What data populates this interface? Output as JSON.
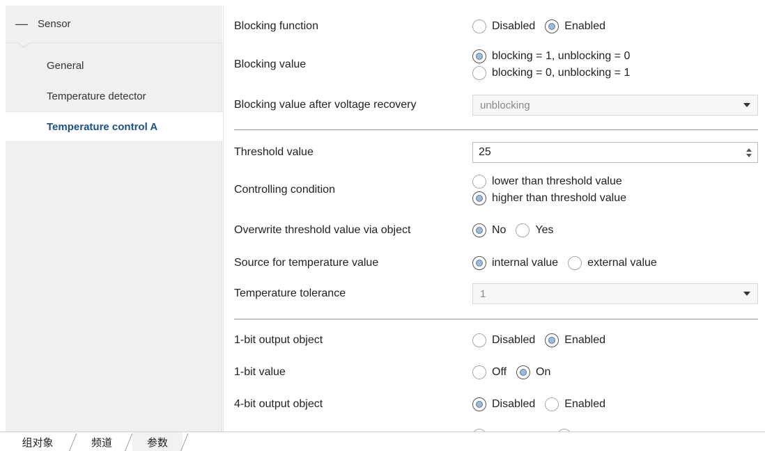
{
  "sidebar": {
    "root_label": "Sensor",
    "items": [
      {
        "label": "General",
        "active": false
      },
      {
        "label": "Temperature detector",
        "active": false
      },
      {
        "label": "Temperature control A",
        "active": true
      }
    ]
  },
  "params": {
    "blocking_function": {
      "label": "Blocking function",
      "opt1": "Disabled",
      "opt2": "Enabled",
      "selected": "Enabled"
    },
    "blocking_value": {
      "label": "Blocking value",
      "opt1": "blocking = 1, unblocking = 0",
      "opt2": "blocking = 0, unblocking = 1",
      "selected": "blocking = 1, unblocking = 0"
    },
    "blocking_after_recovery": {
      "label": "Blocking value after voltage recovery",
      "value": "unblocking"
    },
    "threshold_value": {
      "label": "Threshold value",
      "value": "25"
    },
    "controlling_condition": {
      "label": "Controlling condition",
      "opt1": "lower than threshold value",
      "opt2": "higher than threshold value",
      "selected": "higher than threshold value"
    },
    "overwrite_threshold": {
      "label": "Overwrite threshold value via object",
      "opt1": "No",
      "opt2": "Yes",
      "selected": "No"
    },
    "source_temperature": {
      "label": "Source for temperature value",
      "opt1": "internal value",
      "opt2": "external value",
      "selected": "internal value"
    },
    "temperature_tolerance": {
      "label": "Temperature tolerance",
      "value": "1"
    },
    "output_1bit": {
      "label": "1-bit output object",
      "opt1": "Disabled",
      "opt2": "Enabled",
      "selected": "Enabled"
    },
    "value_1bit": {
      "label": "1-bit value",
      "opt1": "Off",
      "opt2": "On",
      "selected": "On"
    },
    "output_4bit": {
      "label": "4-bit output object",
      "opt1": "Disabled",
      "opt2": "Enabled",
      "selected": "Disabled"
    }
  },
  "tabs": [
    {
      "label": "组对象",
      "active": false
    },
    {
      "label": "频道",
      "active": false
    },
    {
      "label": "参数",
      "active": true
    }
  ],
  "colors": {
    "accent": "#1b4f8a",
    "radio_fill": "#9fb9d6",
    "sidebar_bg": "#f0f0f0"
  }
}
